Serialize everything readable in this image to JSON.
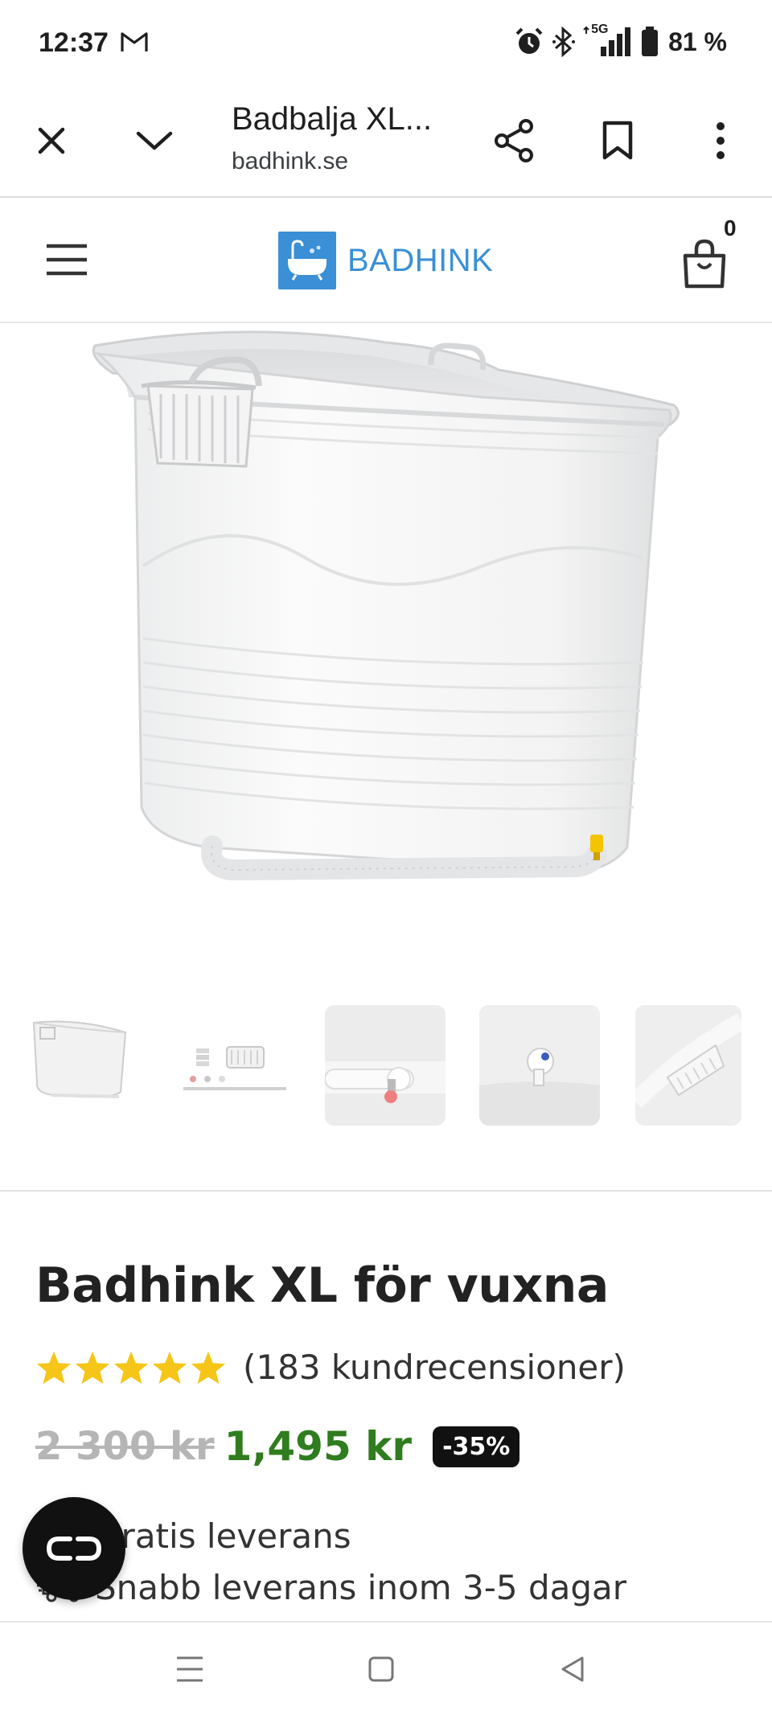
{
  "status_bar": {
    "time": "12:37",
    "network": "5G",
    "battery": "81 %"
  },
  "browser": {
    "page_title": "Badbalja XL...",
    "url": "badhink.se"
  },
  "site_header": {
    "logo_text": "BADHINK",
    "cart_count": "0"
  },
  "product": {
    "title": "Badhink XL för vuxna",
    "rating": 5,
    "review_count": "(183 kundrecensioner)",
    "price_old": "2 300 kr",
    "price_new": "1,495 kr",
    "discount": "-35%",
    "features": [
      {
        "icon": "truck-icon",
        "text": "Gratis leverans"
      },
      {
        "icon": "truck-fast-icon",
        "text": "Snabb leverans inom 3-5 dagar"
      }
    ],
    "thumbnails": [
      {
        "icon": "bathtub-thumbnail"
      },
      {
        "icon": "accessories-thumbnail"
      },
      {
        "icon": "hose-valve-thumbnail"
      },
      {
        "icon": "drain-plug-thumbnail"
      },
      {
        "icon": "basket-thumbnail"
      }
    ]
  },
  "colors": {
    "brand_blue": "#3a8fd6",
    "price_green": "#2f7d1e",
    "star_yellow": "#f5c518"
  }
}
